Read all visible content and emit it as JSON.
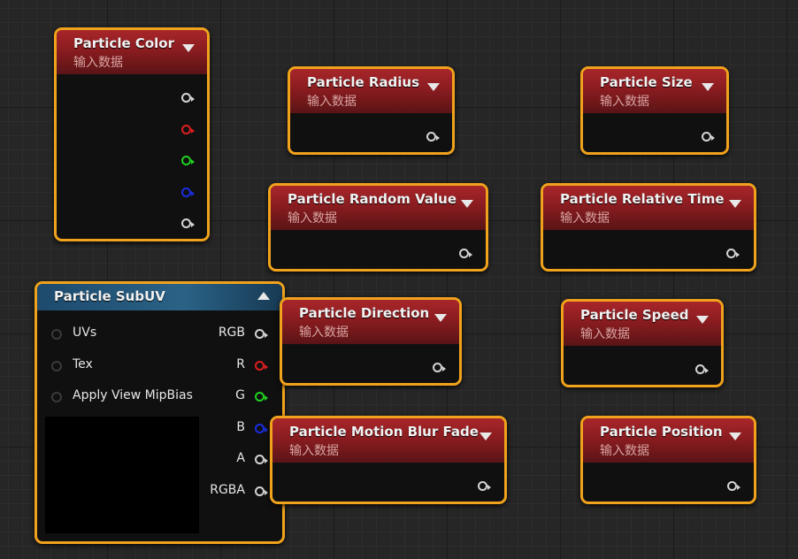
{
  "node_subtitle": "输入数据",
  "colors": {
    "border": "#f0a21c",
    "header_red": "#a8262a",
    "header_blue": "#2a6286"
  },
  "nodes": {
    "color": {
      "title": "Particle Color"
    },
    "radius": {
      "title": "Particle Radius"
    },
    "size": {
      "title": "Particle Size"
    },
    "random": {
      "title": "Particle Random Value"
    },
    "relative_time": {
      "title": "Particle Relative Time"
    },
    "direction": {
      "title": "Particle Direction"
    },
    "speed": {
      "title": "Particle Speed"
    },
    "motion_blur": {
      "title": "Particle Motion Blur Fade"
    },
    "position": {
      "title": "Particle Position"
    },
    "subuv": {
      "title": "Particle SubUV",
      "inputs": [
        "UVs",
        "Tex",
        "Apply View MipBias"
      ],
      "outputs": [
        "RGB",
        "R",
        "G",
        "B",
        "A",
        "RGBA"
      ]
    }
  },
  "icons": {
    "collapse": "triangle-down-icon",
    "expand": "triangle-up-icon",
    "pin": "exec-pin-icon"
  }
}
